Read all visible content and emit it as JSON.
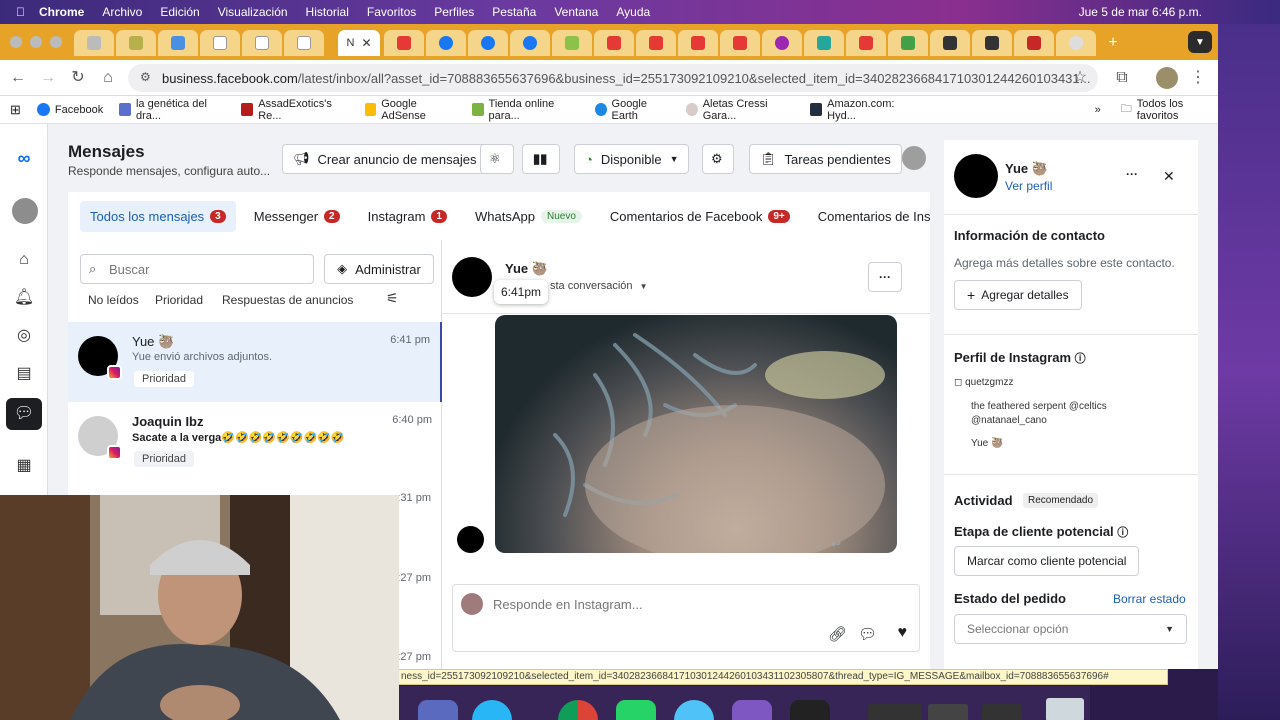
{
  "menubar": {
    "app": "Chrome",
    "items": [
      "Archivo",
      "Edición",
      "Visualización",
      "Historial",
      "Favoritos",
      "Perfiles",
      "Pestaña",
      "Ventana",
      "Ayuda"
    ],
    "clock": "Jue 5 de mar  6:46 p.m."
  },
  "browser": {
    "url_host": "business.facebook.com",
    "url_path": "/latest/inbox/all?asset_id=708883655637696&business_id=255173092109210&selected_item_id=340282366841710301244260103431...",
    "bookmarks": [
      "Facebook",
      "la genética del dra...",
      "AssadExotics's Re...",
      "Google AdSense",
      "Tienda online para...",
      "Google Earth",
      "Aletas Cressi Gara...",
      "Amazon.com: Hyd..."
    ],
    "all_bookmarks": "Todos los favoritos",
    "status_url": "ness_id=255173092109210&selected_item_id=340282366841710301244260103431102305807&thread_type=IG_MESSAGE&mailbox_id=708883655637696#"
  },
  "header": {
    "title": "Mensajes",
    "subtitle": "Responde mensajes, configura auto...",
    "create_ad": "Crear anuncio de mensajes",
    "availability": "Disponible",
    "pending_tasks": "Tareas pendientes"
  },
  "tabs": [
    {
      "label": "Todos los mensajes",
      "badge": "3"
    },
    {
      "label": "Messenger",
      "badge": "2"
    },
    {
      "label": "Instagram",
      "badge": "1"
    },
    {
      "label": "WhatsApp",
      "badge": "Nuevo"
    },
    {
      "label": "Comentarios de Facebook",
      "badge": "9+"
    },
    {
      "label": "Comentarios de Instag",
      "badge": ""
    }
  ],
  "list": {
    "search_placeholder": "Buscar",
    "admin": "Administrar",
    "filters": [
      "No leídos",
      "Prioridad",
      "Respuestas de anuncios"
    ],
    "conversations": [
      {
        "name": "Yue 🦥",
        "preview": "Yue envió archivos adjuntos.",
        "time": "6:41 pm",
        "tag": "Prioridad"
      },
      {
        "name": "Joaquin Ibz",
        "preview": "Sacate a la verga🤣🤣🤣🤣🤣🤣🤣🤣🤣",
        "time": "6:40 pm",
        "tag": "Prioridad"
      },
      {
        "name": "",
        "preview": "",
        "time": ":31 pm",
        "tag": ""
      },
      {
        "name": "",
        "preview": "",
        "time": ":27 pm",
        "tag": ""
      },
      {
        "name": "",
        "preview": "",
        "time": ":27 pm",
        "tag": ""
      }
    ]
  },
  "chat": {
    "name": "Yue 🦥",
    "tooltip_time": "6:41pm",
    "assign": "sta conversación",
    "reply_placeholder": "Responde en Instagram..."
  },
  "contact": {
    "name": "Yue 🦥",
    "view_profile": "Ver perfil",
    "info_title": "Información de contacto",
    "info_text": "Agrega más detalles sobre este contacto.",
    "add_details": "Agregar detalles",
    "ig_title": "Perfil de Instagram",
    "ig_user": "quetzgmzz",
    "ig_bio1": "the feathered serpent @celtics",
    "ig_bio2": "@natanael_cano",
    "ig_name": "Yue 🦥",
    "activity": "Actividad",
    "recommended": "Recomendado",
    "lead_stage": "Etapa de cliente potencial",
    "mark_lead": "Marcar como cliente potencial",
    "order_state": "Estado del pedido",
    "clear_state": "Borrar estado",
    "select_option": "Seleccionar opción"
  }
}
